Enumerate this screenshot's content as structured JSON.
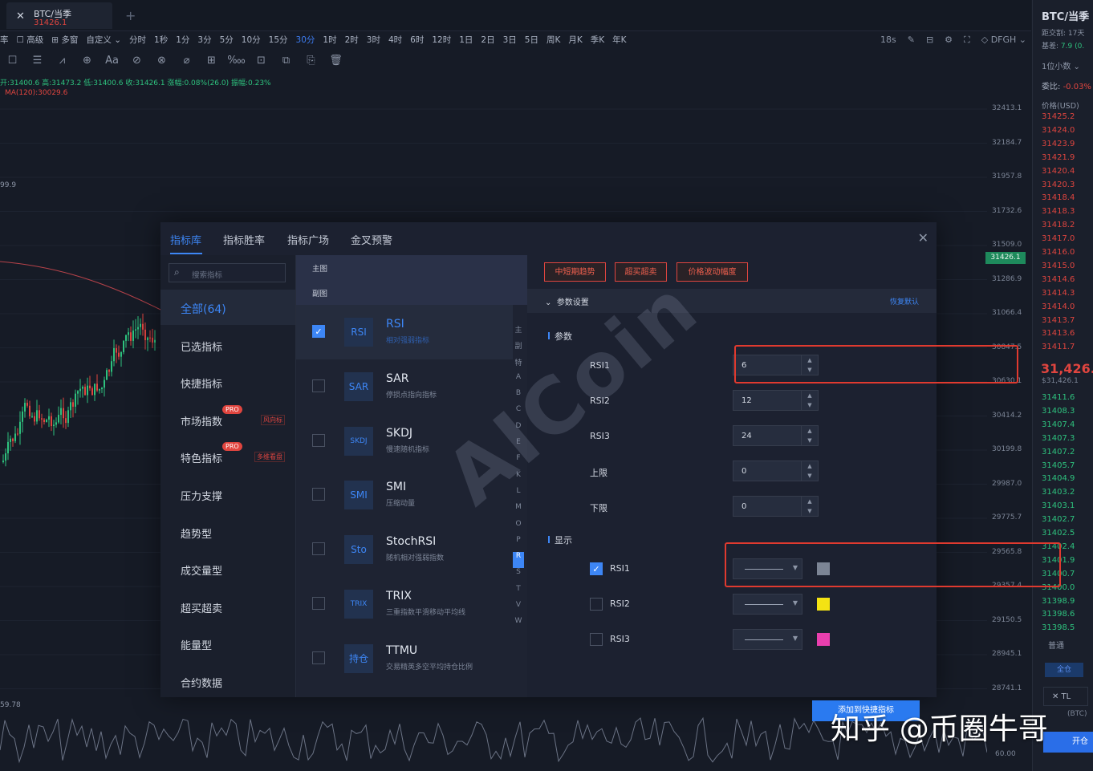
{
  "tab": {
    "symbol": "BTC/当季",
    "price": "31426.1",
    "add": "+"
  },
  "timeframes": [
    "率",
    "☐ 高级",
    "⊞ 多窗",
    "自定义 ⌄",
    "分时",
    "1秒",
    "1分",
    "3分",
    "5分",
    "10分",
    "15分",
    "30分",
    "1时",
    "2时",
    "3时",
    "4时",
    "6时",
    "12时",
    "1日",
    "2日",
    "3日",
    "5日",
    "周K",
    "月K",
    "季K",
    "年K"
  ],
  "active_timeframe_index": 11,
  "toolbar_right": [
    "18s",
    "✎",
    "⊟",
    "⚙",
    "⛶",
    "◇ DFGH ⌄"
  ],
  "tools": [
    "☐",
    "☰",
    "⩘",
    "⊕",
    "Aa",
    "⊘",
    "⊗",
    "⌀",
    "⊞",
    "‱",
    "⊡",
    "⧉",
    "⎘",
    "🗑"
  ],
  "ohlc_text": "开:31400.6  高:31473.2  低:31400.6  收:31426.1  涨幅:0.08%(26.0)  振幅:0.23%",
  "ma_text": "MA(120):30029.6",
  "left_values": [
    "99.9",
    "59.78"
  ],
  "price_axis": [
    "32413.1",
    "32184.7",
    "31957.8",
    "31732.6",
    "31509.0",
    "31286.9",
    "31066.4",
    "30847.5",
    "30630.1",
    "30414.2",
    "30199.8",
    "29987.0",
    "29775.7",
    "29565.8",
    "29357.4",
    "29150.5",
    "28945.1",
    "28741.1"
  ],
  "axis_current": "31426.1",
  "osc_axis": "60.00",
  "right_panel": {
    "title": "BTC/当季",
    "line1": "距交割: 17天",
    "line2_label": "基差:",
    "line2_value": "7.9 (0.",
    "decimals": "1位小数 ⌄",
    "ratio_label": "委比:",
    "ratio_value": "-0.03%",
    "price_header": "价格(USD)",
    "asks": [
      "31425.2",
      "31424.0",
      "31423.9",
      "31421.9",
      "31420.4",
      "31420.3",
      "31418.4",
      "31418.3",
      "31418.2",
      "31417.0",
      "31416.0",
      "31415.0",
      "31414.6",
      "31414.3",
      "31414.0",
      "31413.7",
      "31413.6",
      "31411.7"
    ],
    "last": "31,426.1",
    "last_usd": "$31,426.1",
    "bids": [
      "31411.6",
      "31408.3",
      "31407.4",
      "31407.3",
      "31407.2",
      "31405.7",
      "31404.9",
      "31403.2",
      "31403.1",
      "31402.7",
      "31402.5",
      "31402.4",
      "31401.9",
      "31400.7",
      "31400.0",
      "31398.9",
      "31398.6",
      "31398.5"
    ],
    "normal": "普通",
    "all": "全仓",
    "tl": "✕  TL",
    "btc": "(BTC)",
    "open": "开仓"
  },
  "modal": {
    "tabs": [
      "指标库",
      "指标胜率",
      "指标广场",
      "金叉预警"
    ],
    "close": "✕",
    "search_placeholder": "搜索指标",
    "categories": [
      {
        "label": "全部(64)"
      },
      {
        "label": "已选指标"
      },
      {
        "label": "快捷指标"
      },
      {
        "label": "市场指数",
        "badge": "PRO",
        "tag": "风向标"
      },
      {
        "label": "特色指标",
        "badge": "PRO",
        "tag": "多维看盘"
      },
      {
        "label": "压力支撑"
      },
      {
        "label": "趋势型"
      },
      {
        "label": "成交量型"
      },
      {
        "label": "超买超卖"
      },
      {
        "label": "能量型"
      },
      {
        "label": "合约数据"
      }
    ],
    "segments": [
      "主图",
      "副图"
    ],
    "indicators": [
      {
        "badge": "RSI",
        "name": "RSI",
        "desc": "相对强弱指标",
        "checked": true
      },
      {
        "badge": "SAR",
        "name": "SAR",
        "desc": "停损点指向指标",
        "checked": false
      },
      {
        "badge": "SKDJ",
        "name": "SKDJ",
        "desc": "慢速随机指标",
        "checked": false
      },
      {
        "badge": "SMI",
        "name": "SMI",
        "desc": "压缩动量",
        "checked": false
      },
      {
        "badge": "Sto",
        "name": "StochRSI",
        "desc": "随机相对强弱指数",
        "checked": false
      },
      {
        "badge": "TRIX",
        "name": "TRIX",
        "desc": "三重指数平滑移动平均线",
        "checked": false
      },
      {
        "badge": "持仓",
        "name": "TTMU",
        "desc": "交易精英多空平均持仓比例",
        "checked": false
      }
    ],
    "letters": [
      "主",
      "副",
      "特",
      "A",
      "B",
      "C",
      "D",
      "E",
      "F",
      "K",
      "L",
      "M",
      "O",
      "P",
      "R",
      "S",
      "T",
      "V",
      "W"
    ],
    "active_letter_index": 14,
    "quick_tags": [
      "中短期趋势",
      "超买超卖",
      "价格波动幅度"
    ],
    "param_header": "参数设置",
    "restore_default": "恢复默认",
    "params_title": "参数",
    "params": [
      {
        "label": "RSI1",
        "value": "6"
      },
      {
        "label": "RSI2",
        "value": "12"
      },
      {
        "label": "RSI3",
        "value": "24"
      },
      {
        "label": "上限",
        "value": "0"
      },
      {
        "label": "下限",
        "value": "0"
      }
    ],
    "display_title": "显示",
    "display": [
      {
        "label": "RSI1",
        "checked": true,
        "color": "#7c8595"
      },
      {
        "label": "RSI2",
        "checked": false,
        "color": "#f4e313"
      },
      {
        "label": "RSI3",
        "checked": false,
        "color": "#e93fae"
      }
    ],
    "add_button": "添加到快捷指标"
  },
  "watermark": "AICoin",
  "footer_credit": "知乎 @币圈牛哥"
}
